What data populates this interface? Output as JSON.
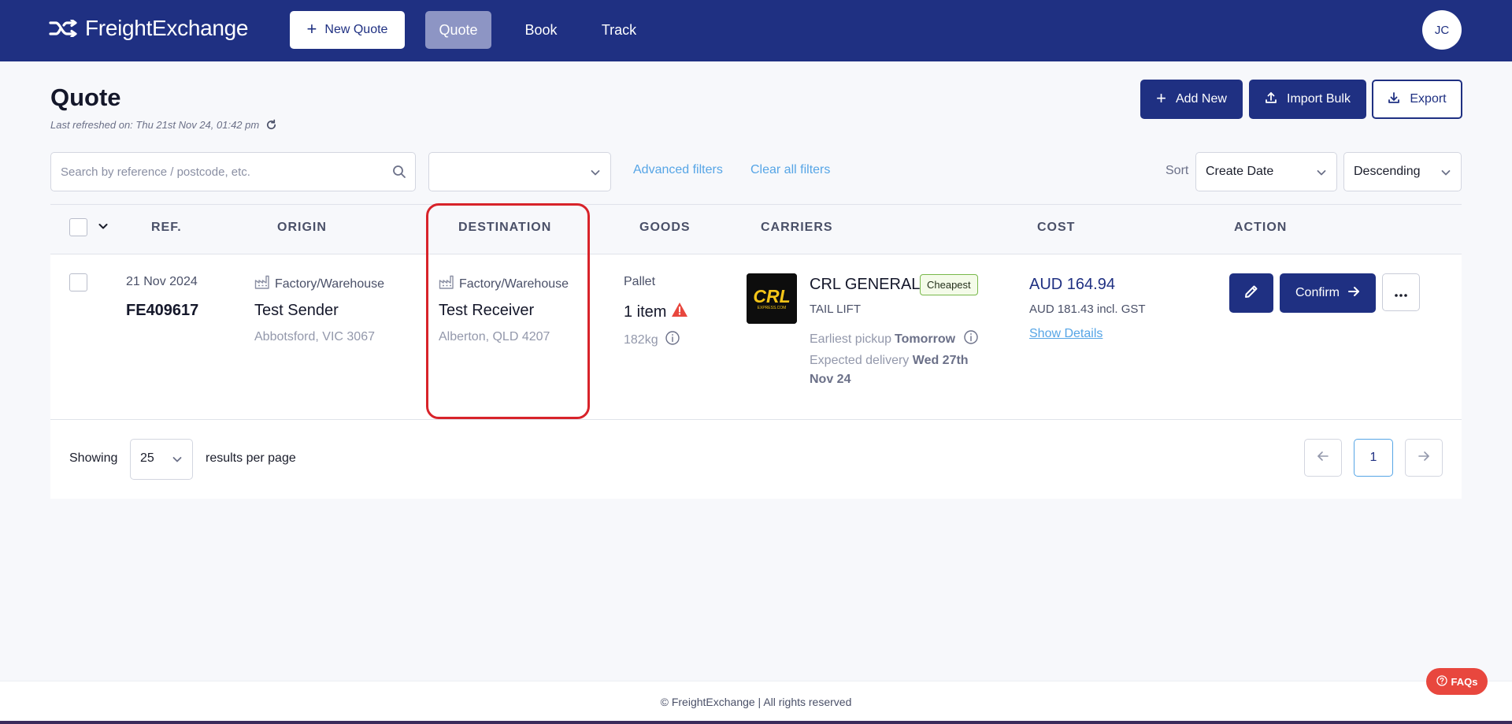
{
  "brand": {
    "name": "FreightExchange"
  },
  "nav": {
    "new_quote": "New Quote",
    "quote": "Quote",
    "book": "Book",
    "track": "Track",
    "avatar_initials": "JC"
  },
  "page": {
    "title": "Quote",
    "refreshed": "Last refreshed on: Thu 21st Nov 24, 01:42 pm"
  },
  "actions": {
    "add_new": "Add New",
    "import_bulk": "Import Bulk",
    "export": "Export"
  },
  "filters": {
    "search_placeholder": "Search by reference / postcode, etc.",
    "search_value": "",
    "status_value": "",
    "advanced": "Advanced filters",
    "clear": "Clear all filters",
    "sort_label": "Sort",
    "sort_field": "Create Date",
    "sort_direction": "Descending"
  },
  "table": {
    "headers": {
      "ref": "REF.",
      "origin": "ORIGIN",
      "destination": "DESTINATION",
      "goods": "GOODS",
      "carriers": "CARRIERS",
      "cost": "COST",
      "action": "ACTION"
    },
    "rows": [
      {
        "date": "21 Nov 2024",
        "ref": "FE409617",
        "origin": {
          "type": "Factory/Warehouse",
          "name": "Test Sender",
          "location": "Abbotsford, VIC 3067"
        },
        "destination": {
          "type": "Factory/Warehouse",
          "name": "Test Receiver",
          "location": "Alberton, QLD 4207"
        },
        "goods": {
          "type": "Pallet",
          "count": "1 item",
          "weight": "182kg"
        },
        "carrier": {
          "logo_text": "CRL",
          "logo_subtext": "EXPRESS.COM",
          "name": "CRL GENERAL",
          "badge": "Cheapest",
          "service": "TAIL LIFT",
          "pickup_label": "Earliest pickup",
          "pickup_value": "Tomorrow",
          "delivery_label": "Expected delivery",
          "delivery_value": "Wed 27th Nov 24"
        },
        "cost": {
          "price": "AUD 164.94",
          "incl_gst": "AUD 181.43 incl. GST",
          "details_link": "Show Details"
        },
        "confirm": "Confirm"
      }
    ]
  },
  "pagination": {
    "showing": "Showing",
    "per_page": "25",
    "per_page_suffix": "results per page",
    "current_page": "1"
  },
  "footer": {
    "copyright": "© FreightExchange | All rights reserved"
  },
  "faqs": "FAQs",
  "colors": {
    "brand_navy": "#1f3082",
    "link_blue": "#56a5e6",
    "highlight_red": "#d8232a",
    "badge_green": "#78b84a",
    "warning_red": "#e8473e",
    "carrier_logo_yellow": "#f5c518"
  },
  "icons": [
    "shuffle-logo-icon",
    "plus-icon",
    "refresh-icon",
    "upload-icon",
    "download-icon",
    "search-icon",
    "chevron-down-icon",
    "factory-icon",
    "warning-icon",
    "info-icon",
    "pencil-icon",
    "arrow-right-icon",
    "more-icon",
    "arrow-left-icon",
    "question-icon"
  ]
}
